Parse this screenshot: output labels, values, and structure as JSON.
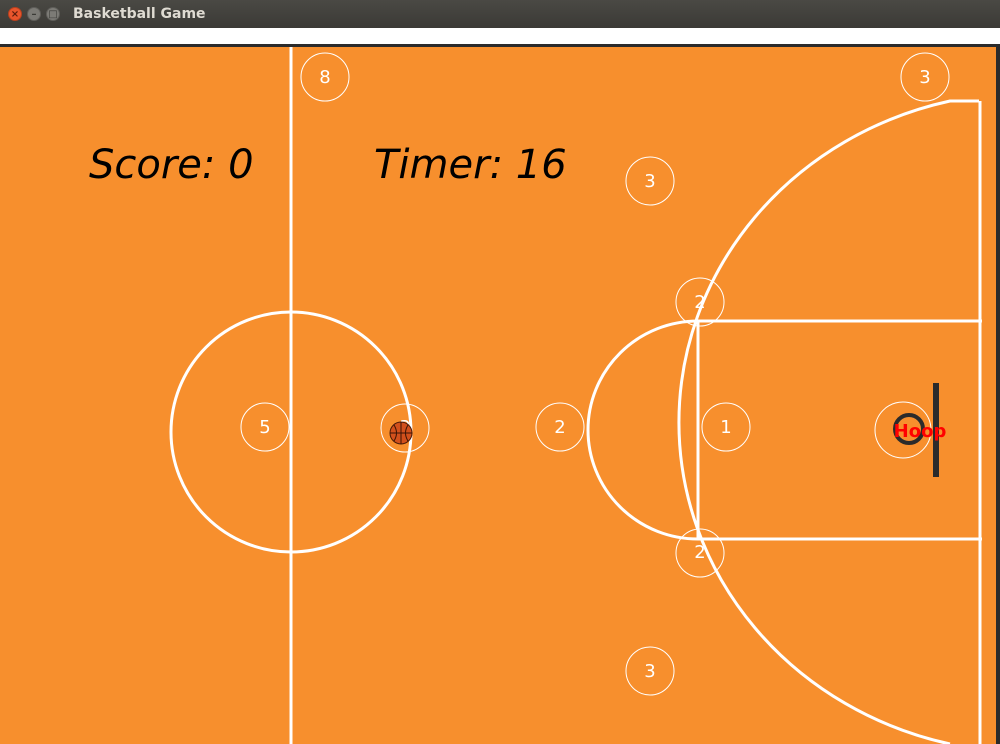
{
  "window": {
    "title": "Basketball Game"
  },
  "hud": {
    "score_label": "Score: 0",
    "timer_label": "Timer: 16"
  },
  "spots": [
    {
      "id": "spot-8",
      "label": "8"
    },
    {
      "id": "spot-3-top-right",
      "label": "3"
    },
    {
      "id": "spot-3-upper",
      "label": "3"
    },
    {
      "id": "spot-2-top",
      "label": "2"
    },
    {
      "id": "spot-5",
      "label": "5"
    },
    {
      "id": "spot-3-ball",
      "label": "3"
    },
    {
      "id": "spot-2-left",
      "label": "2"
    },
    {
      "id": "spot-1",
      "label": "1"
    },
    {
      "id": "spot-2-bottom",
      "label": "2"
    },
    {
      "id": "spot-3-lower",
      "label": "3"
    }
  ],
  "hoop": {
    "label": "Hoop"
  },
  "colors": {
    "court": "#f78f2d",
    "lines": "#ffffff",
    "hoop_label": "#ff0000",
    "ball": "#d2501c"
  }
}
